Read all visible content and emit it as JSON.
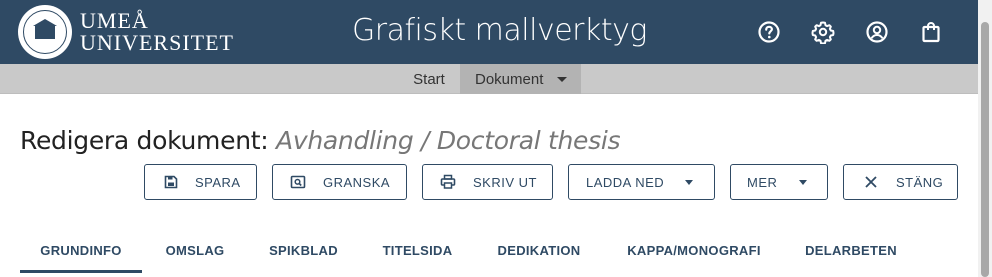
{
  "header": {
    "logo_line1": "UMEÅ",
    "logo_line2": "UNIVERSITET",
    "logo_seal_text": "UMEÅ UNIVERSITET",
    "app_title": "Grafiskt mallverktyg",
    "icons": [
      "help-icon",
      "settings-gear-icon",
      "account-icon",
      "shopping-bag-icon"
    ],
    "background": "#2f4a64"
  },
  "subnav": {
    "items": [
      {
        "label": "Start"
      },
      {
        "label": "Dokument"
      }
    ],
    "active": "Dokument"
  },
  "page": {
    "title_prefix": "Redigera dokument:",
    "document_name": "Avhandling / Doctoral thesis"
  },
  "toolbar": {
    "save_label": "SPARA",
    "review_label": "GRANSKA",
    "print_label": "SKRIV UT",
    "download_label": "LADDA NED",
    "more_label": "MER",
    "close_label": "STÄNG"
  },
  "tabs": {
    "items": [
      {
        "label": "GRUNDINFO"
      },
      {
        "label": "OMSLAG"
      },
      {
        "label": "SPIKBLAD"
      },
      {
        "label": "TITELSIDA"
      },
      {
        "label": "DEDIKATION"
      },
      {
        "label": "KAPPA/MONOGRAFI"
      },
      {
        "label": "DELARBETEN"
      }
    ],
    "active": "GRUNDINFO"
  },
  "colors": {
    "primary": "#2f4a64",
    "subnav_bg": "#c9c9c9",
    "subnav_active": "#b3b3b3"
  }
}
